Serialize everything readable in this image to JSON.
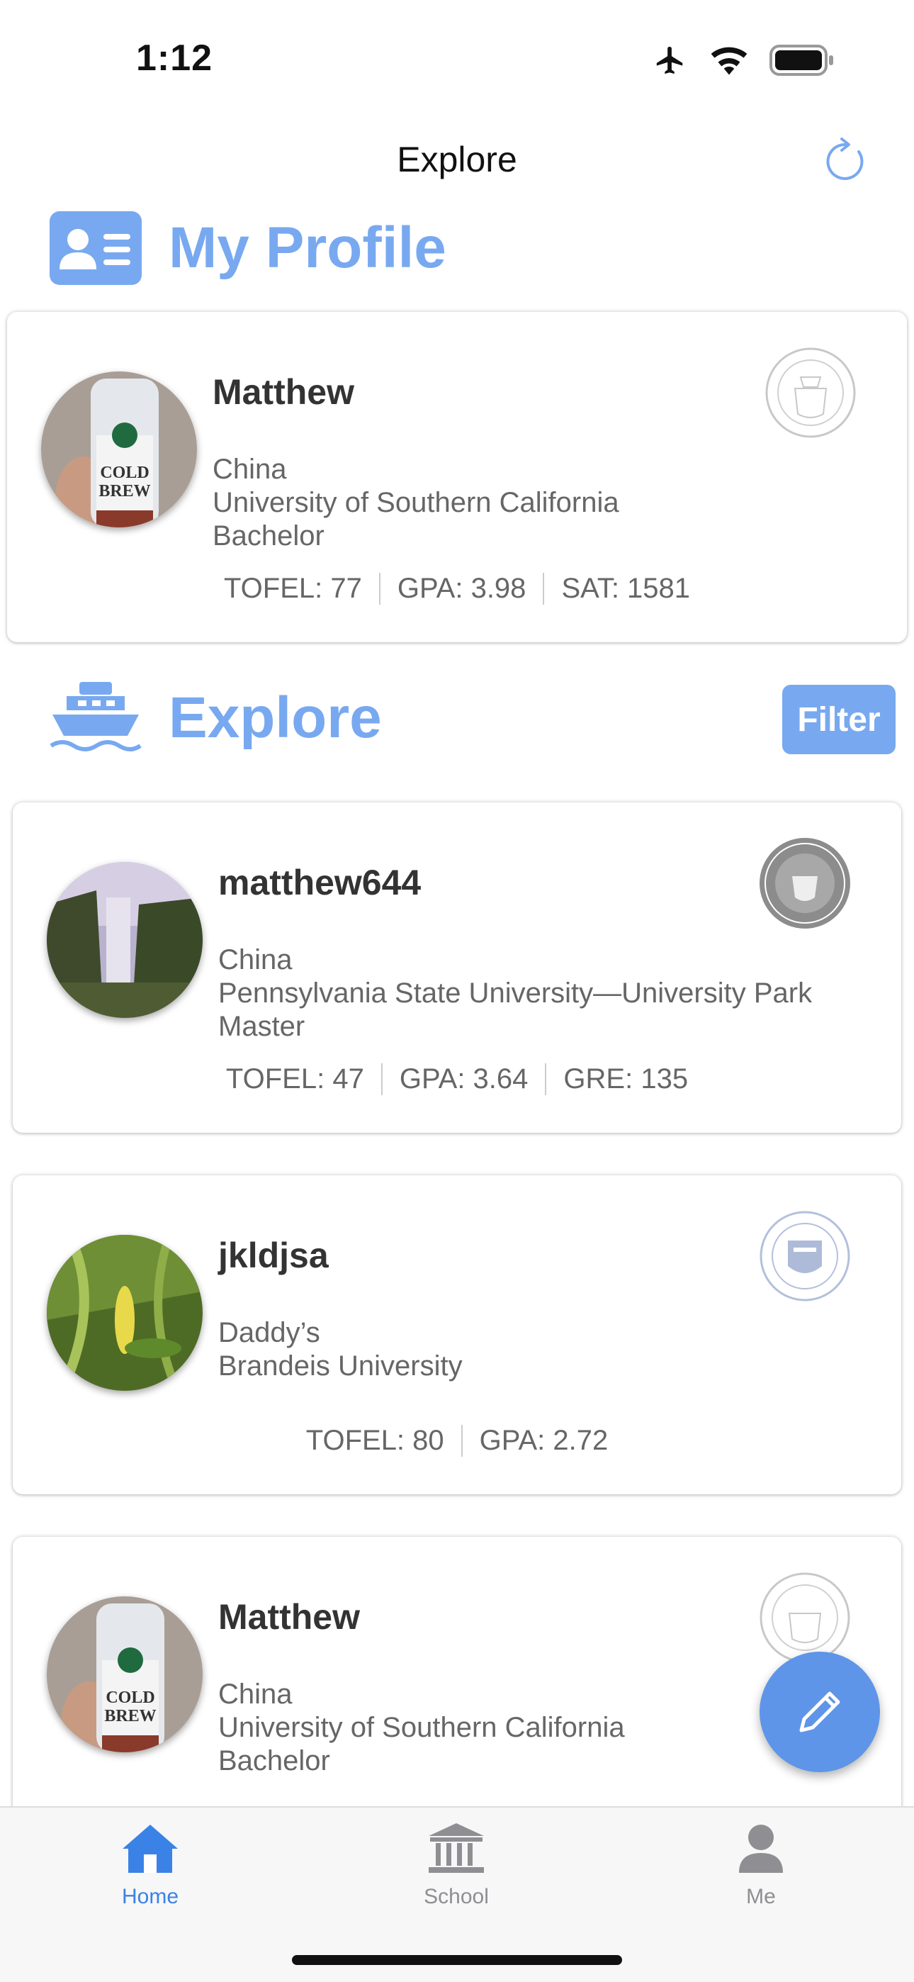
{
  "status_bar": {
    "time": "1:12"
  },
  "nav": {
    "title": "Explore"
  },
  "my_profile": {
    "section_title": "My Profile",
    "card": {
      "name": "Matthew",
      "country": "China",
      "school": "University of Southern California",
      "degree": "Bachelor",
      "stats": [
        "TOFEL: 77",
        "GPA: 3.98",
        "SAT: 1581"
      ]
    }
  },
  "explore": {
    "section_title": "Explore",
    "filter_label": "Filter",
    "cards": [
      {
        "name": "matthew644",
        "country": "China",
        "school": "Pennsylvania State University—University Park",
        "degree": "Master",
        "stats": [
          "TOFEL: 47",
          "GPA: 3.64",
          "GRE: 135"
        ]
      },
      {
        "name": "jkldjsa",
        "country": "Daddy’s",
        "school": "Brandeis University",
        "stats": [
          "TOFEL: 80",
          "GPA: 2.72"
        ]
      },
      {
        "name": "Matthew",
        "country": "China",
        "school": "University of Southern California",
        "degree": "Bachelor"
      }
    ]
  },
  "tab_bar": {
    "items": [
      {
        "label": "Home",
        "icon": "home-icon",
        "active": true
      },
      {
        "label": "School",
        "icon": "school-icon",
        "active": false
      },
      {
        "label": "Me",
        "icon": "person-icon",
        "active": false
      }
    ]
  },
  "colors": {
    "accent": "#78a9f0",
    "tab_active": "#3b82e6",
    "tab_inactive": "#8e8e93",
    "fab": "#5e95e8"
  }
}
